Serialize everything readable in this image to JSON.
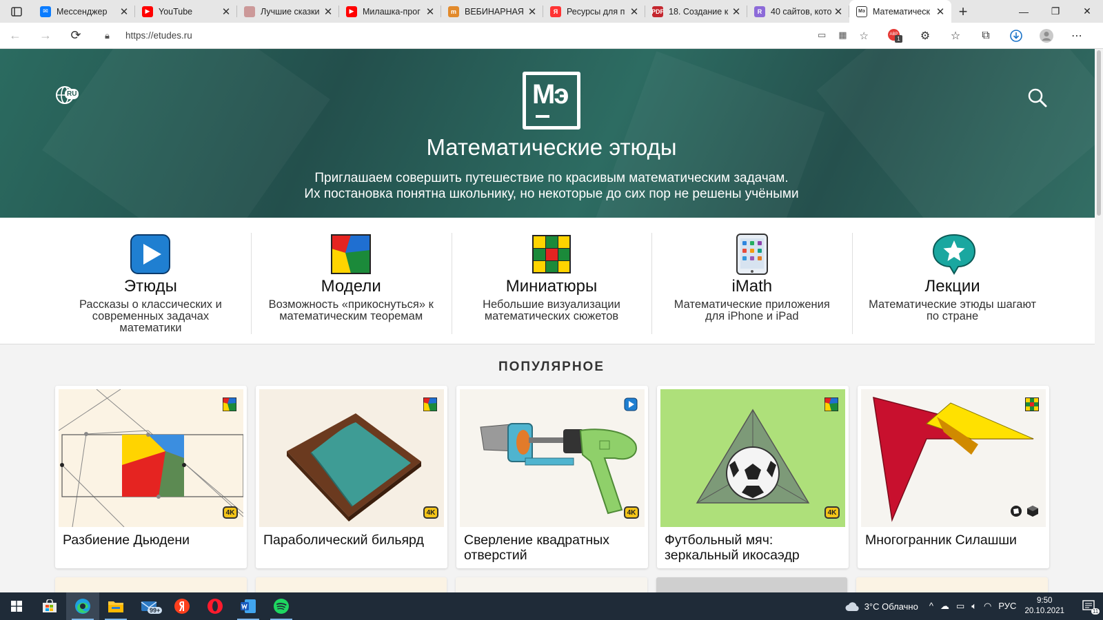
{
  "browser": {
    "tabs": [
      {
        "title": "Мессенджер",
        "color": "#0a7cff",
        "glyph": "✉"
      },
      {
        "title": "YouTube",
        "color": "#ff0000",
        "glyph": "▶"
      },
      {
        "title": "Лучшие сказки",
        "color": "#c99",
        "glyph": ""
      },
      {
        "title": "Милашка-прог",
        "color": "#ff0000",
        "glyph": "▶"
      },
      {
        "title": "ВЕБИНАРНАЯ",
        "color": "#e28a2b",
        "glyph": "m"
      },
      {
        "title": "Ресурсы для п",
        "color": "#f33",
        "glyph": "Я"
      },
      {
        "title": "18. Создание к",
        "color": "#c4262e",
        "glyph": "PDF"
      },
      {
        "title": "40 сайтов, кото",
        "color": "#8c6ad8",
        "glyph": "R"
      },
      {
        "title": "Математическ",
        "color": "#ffffff",
        "glyph": "Мэ",
        "active": true
      }
    ],
    "url": "https://etudes.ru",
    "extension_badge": "1"
  },
  "hero": {
    "title": "Математические этюды",
    "subtitle_line1": "Приглашаем совершить путешествие по красивым математическим задачам.",
    "subtitle_line2": "Их постановка понятна школьнику, но некоторые до сих пор не решены учёными",
    "lang": "RU",
    "logo_text": "Мэ"
  },
  "sections": [
    {
      "title": "Этюды",
      "desc": "Рассказы о классических и современных задачах математики"
    },
    {
      "title": "Модели",
      "desc": "Возможность «прикоснуться» к математическим теоремам"
    },
    {
      "title": "Миниатюры",
      "desc": "Небольшие визуализации математических сюжетов"
    },
    {
      "title": "iMath",
      "desc": "Математические приложения для iPhone и iPad"
    },
    {
      "title": "Лекции",
      "desc": "Математические этюды шагают по стране"
    }
  ],
  "popular": {
    "title": "ПОПУЛЯРНОЕ",
    "cards": [
      {
        "title": "Разбиение Дьюдени",
        "badge": "4K"
      },
      {
        "title": "Параболический бильярд",
        "badge": "4K"
      },
      {
        "title": "Сверление квадратных отверстий",
        "badge": "4K"
      },
      {
        "title": "Футбольный мяч: зеркальный икосаэдр",
        "badge": "4K"
      },
      {
        "title": "Многогранник Силашши",
        "badge": ""
      }
    ]
  },
  "taskbar": {
    "mail_badge": "99+",
    "weather": "3°C  Облачно",
    "lang": "РУС",
    "time": "9:50",
    "date": "20.10.2021",
    "notif_count": "11"
  }
}
